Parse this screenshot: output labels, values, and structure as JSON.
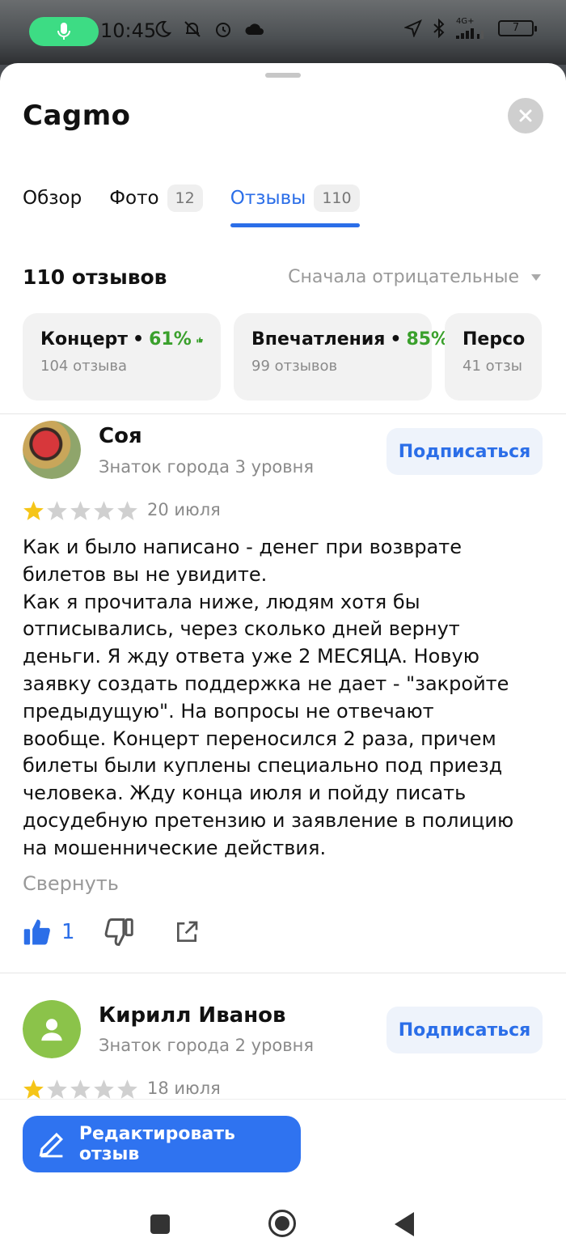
{
  "status_bar": {
    "time": "10:45",
    "network": "4G+",
    "battery": "7",
    "icons": [
      "mic-icon",
      "moon-icon",
      "bell-off-icon",
      "alarm-icon",
      "cloud-icon",
      "location-icon",
      "bluetooth-icon",
      "signal-icon",
      "battery-icon"
    ]
  },
  "sheet": {
    "title": "Cagmo",
    "close_icon": "close-icon"
  },
  "tabs": [
    {
      "label": "Обзор",
      "badge": null,
      "active": false
    },
    {
      "label": "Фото",
      "badge": "12",
      "active": false
    },
    {
      "label": "Отзывы",
      "badge": "110",
      "active": true
    }
  ],
  "reviews_header": {
    "count": "110 отзывов",
    "sort": "Сначала отрицательные"
  },
  "chips": [
    {
      "title": "Концерт",
      "percent": "61%",
      "sub": "104 отзыва"
    },
    {
      "title": "Впечатления",
      "percent": "85%",
      "sub": "99 отзывов"
    },
    {
      "title": "Персо",
      "percent": "",
      "sub": "41 отзы"
    }
  ],
  "reviews": [
    {
      "author": "Соя",
      "level": "Знаток города 3 уровня",
      "subscribe": "Подписаться",
      "rating": 1,
      "date": "20 июля",
      "text": [
        "Как и было написано - денег при возврате",
        "билетов вы не увидите.",
        "Как я прочитала ниже, людям хотя бы",
        "отписывались, через сколько дней вернут",
        "деньги. Я жду ответа уже 2 МЕСЯЦА. Новую",
        "заявку создать поддержка не дает - \"закройте",
        "предыдущую\". На вопросы не отвечают",
        "вообще. Концерт переносился 2 раза, причем",
        "билеты были куплены специально под приезд",
        "человека. Жду конца июля и пойду писать",
        "досудебную претензию и заявление в полицию",
        "на мошеннические действия."
      ],
      "collapse": "Свернуть",
      "likes": "1"
    },
    {
      "author": "Кирилл Иванов",
      "level": "Знаток города 2 уровня",
      "subscribe": "Подписаться",
      "rating": 1,
      "date": "18 июля"
    }
  ],
  "fab": {
    "label": "Редактировать отзыв"
  },
  "colors": {
    "accent": "#2b6ee8",
    "positive": "#3aa02c",
    "star": "#f5c518",
    "star_empty": "#d0d0d0"
  }
}
